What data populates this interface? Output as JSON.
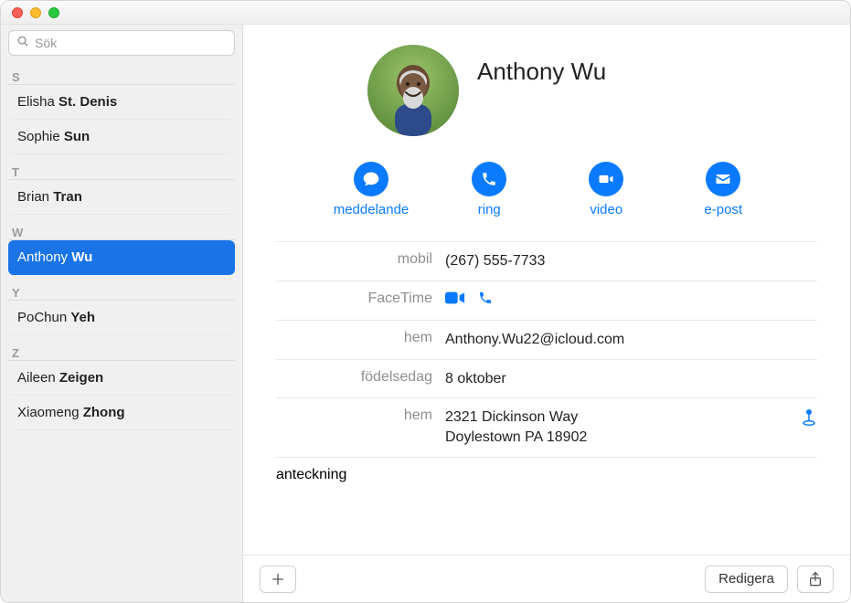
{
  "search": {
    "placeholder": "Sök"
  },
  "sections": [
    {
      "letter": "S",
      "items": [
        {
          "first": "Elisha",
          "last": "St. Denis",
          "selected": false
        },
        {
          "first": "Sophie",
          "last": "Sun",
          "selected": false
        }
      ]
    },
    {
      "letter": "T",
      "items": [
        {
          "first": "Brian",
          "last": "Tran",
          "selected": false
        }
      ]
    },
    {
      "letter": "W",
      "items": [
        {
          "first": "Anthony",
          "last": "Wu",
          "selected": true
        }
      ]
    },
    {
      "letter": "Y",
      "items": [
        {
          "first": "PoChun",
          "last": "Yeh",
          "selected": false
        }
      ]
    },
    {
      "letter": "Z",
      "items": [
        {
          "first": "Aileen",
          "last": "Zeigen",
          "selected": false
        },
        {
          "first": "Xiaomeng",
          "last": "Zhong",
          "selected": false
        }
      ]
    }
  ],
  "contact": {
    "name": "Anthony Wu",
    "actions": {
      "message": "meddelande",
      "call": "ring",
      "video": "video",
      "email": "e-post"
    },
    "labels": {
      "mobile": "mobil",
      "facetime": "FaceTime",
      "home_email": "hem",
      "birthday": "födelsedag",
      "home_addr": "hem",
      "note": "anteckning"
    },
    "values": {
      "mobile": "(267) 555-7733",
      "home_email": "Anthony.Wu22@icloud.com",
      "birthday": "8 oktober",
      "addr_line1": "2321 Dickinson Way",
      "addr_line2": "Doylestown PA 18902"
    }
  },
  "toolbar": {
    "edit": "Redigera"
  },
  "colors": {
    "accent": "#0a7aff",
    "selection": "#1a74e8"
  }
}
